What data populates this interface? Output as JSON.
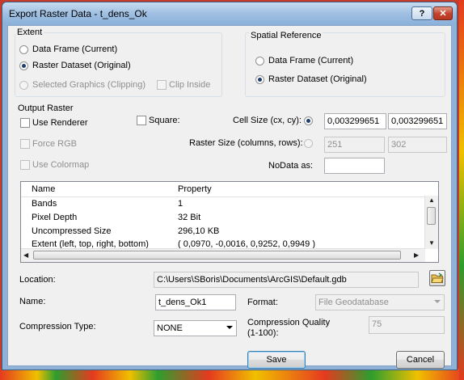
{
  "window": {
    "title": "Export Raster Data - t_dens_Ok",
    "help": "?",
    "close": "✕"
  },
  "extent": {
    "label": "Extent",
    "options": [
      "Data Frame (Current)",
      "Raster Dataset (Original)",
      "Selected Graphics (Clipping)"
    ],
    "selected": "Raster Dataset (Original)",
    "clip_inside": "Clip Inside"
  },
  "spatial_reference": {
    "label": "Spatial Reference",
    "options": [
      "Data Frame (Current)",
      "Raster Dataset (Original)"
    ],
    "selected": "Raster Dataset (Original)"
  },
  "output_raster": {
    "label": "Output Raster",
    "use_renderer": "Use Renderer",
    "square": "Square:",
    "force_rgb": "Force RGB",
    "use_colormap": "Use Colormap",
    "cell_size_label": "Cell Size (cx, cy):",
    "cell_size_cx": "0,003299651",
    "cell_size_cy": "0,003299651",
    "raster_size_label": "Raster Size (columns, rows):",
    "columns": "251",
    "rows": "302",
    "nodata_label": "NoData as:",
    "nodata_value": ""
  },
  "properties": {
    "columns": [
      "Name",
      "Property"
    ],
    "rows": [
      {
        "name": "Bands",
        "value": "1"
      },
      {
        "name": "Pixel Depth",
        "value": "32 Bit"
      },
      {
        "name": "Uncompressed Size",
        "value": "296,10 KB"
      },
      {
        "name": "Extent (left, top, right, bottom)",
        "value": "( 0,0970, -0,0016, 0,9252, 0,9949 )"
      }
    ]
  },
  "location": {
    "label": "Location:",
    "value": "C:\\Users\\SBoris\\Documents\\ArcGIS\\Default.gdb"
  },
  "name": {
    "label": "Name:",
    "value": "t_dens_Ok1"
  },
  "format": {
    "label": "Format:",
    "value": "File Geodatabase"
  },
  "compression_type": {
    "label": "Compression Type:",
    "value": "NONE"
  },
  "compression_quality": {
    "label": "Compression Quality\n(1-100):",
    "line1": "Compression Quality",
    "line2": "(1-100):",
    "value": "75"
  },
  "buttons": {
    "save": "Save",
    "cancel": "Cancel"
  }
}
